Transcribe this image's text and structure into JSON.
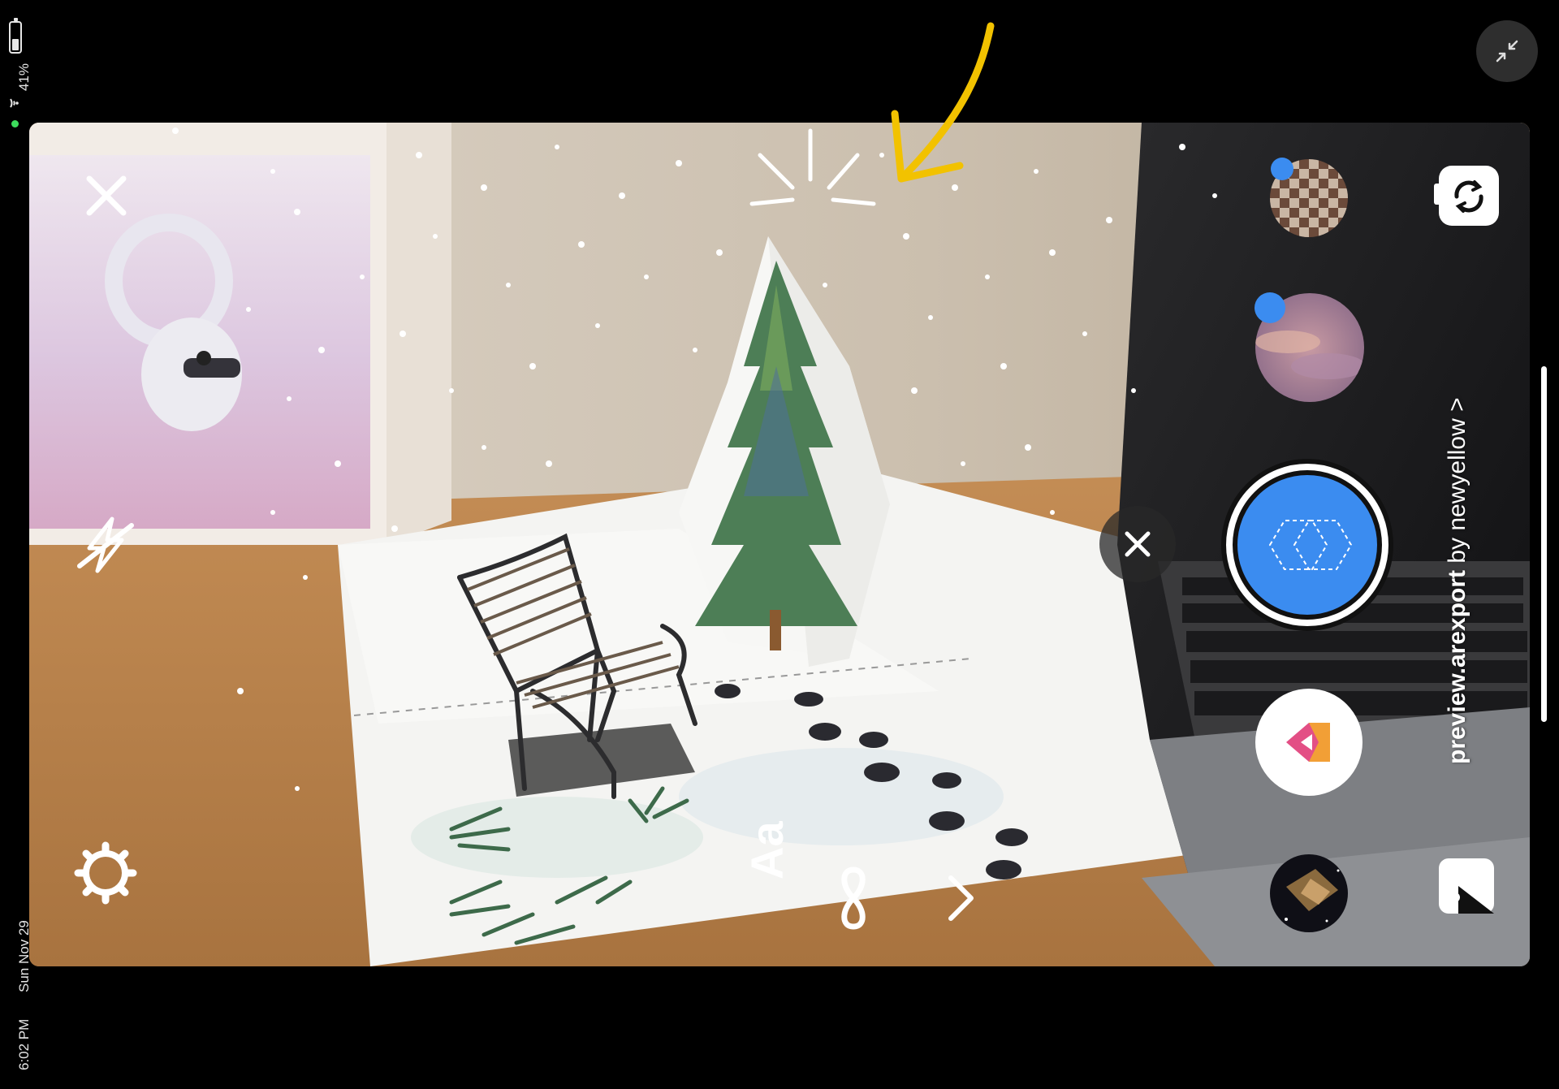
{
  "status_bar": {
    "battery": "41%",
    "date": "Sun Nov 29",
    "time": "6:02 PM"
  },
  "camera": {
    "effect_name": "preview.arexport",
    "effect_author": "by newyellow",
    "effect_chevron": ">",
    "text_tool_label": "Aa",
    "more_tools": "›"
  },
  "icons": {
    "close": "close-icon",
    "flash": "flash-off-icon",
    "settings": "gear-icon",
    "text": "text-aa-icon",
    "boomerang": "infinity-icon",
    "chevron": "chevron-right-icon",
    "flip_camera": "flip-camera-icon",
    "gallery": "gallery-icon",
    "minimize": "minimize-icon",
    "create": "create-mode-icon"
  },
  "colors": {
    "shutter_blue": "#3b8cf0",
    "annotation_yellow": "#f2c200",
    "status_green": "#3ddc5c"
  }
}
